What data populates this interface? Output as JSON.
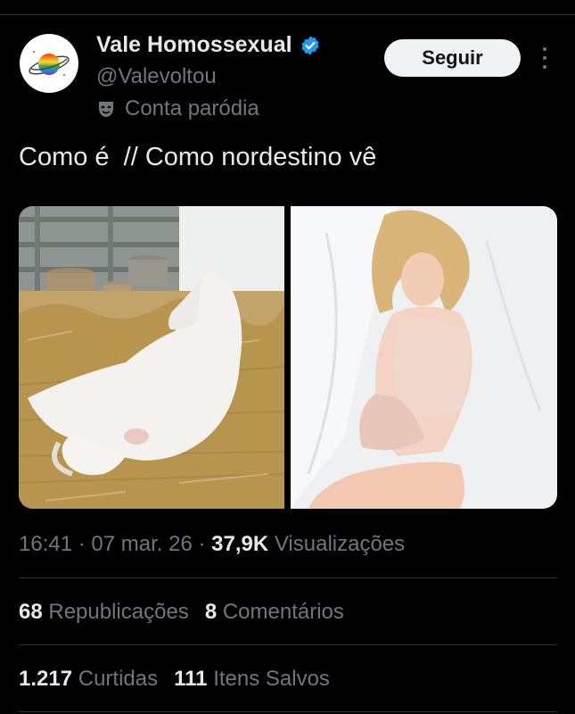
{
  "author": {
    "name": "Vale Homossexual",
    "handle": "@Valevoltou",
    "label": "Conta paródia"
  },
  "follow_button": "Seguir",
  "post": {
    "text": "Como é  // Como nordestino vê"
  },
  "meta": {
    "time": "16:41",
    "sep1": " · ",
    "date": "07 mar. 26",
    "sep2": " · ",
    "views_count": "37,9K",
    "views_label": "Visualizações"
  },
  "stats": {
    "reposts_count": "68",
    "reposts_label": "Republicações",
    "comments_count": "8",
    "comments_label": "Comentários",
    "likes_count": "1.217",
    "likes_label": "Curtidas",
    "saves_count": "111",
    "saves_label": "Itens Salvos"
  },
  "icons": {
    "verified": "verified-badge-icon",
    "parody": "theater-masks-icon",
    "more": "more-vertical-icon"
  },
  "colors": {
    "background": "#000000",
    "primary_text": "#e7e9ea",
    "secondary_text": "#71767b",
    "verified_blue": "#1d9bf0",
    "button_bg": "#eff3f4",
    "divider": "#2f3336"
  }
}
